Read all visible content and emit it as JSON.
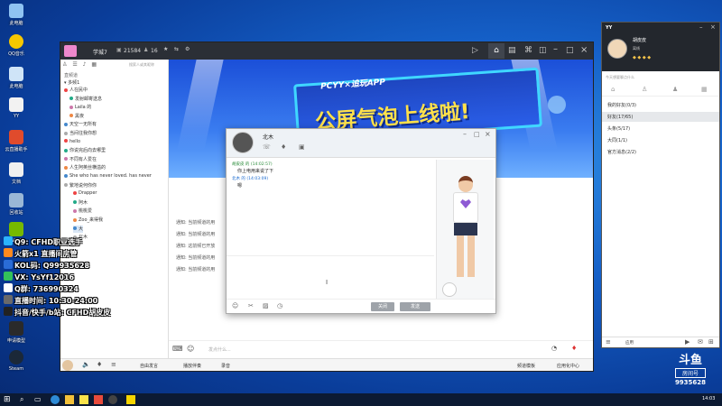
{
  "desktop": {
    "icons": [
      {
        "label": "此电脑"
      },
      {
        "label": "QQ音乐"
      },
      {
        "label": "此电脑"
      },
      {
        "label": "YY"
      },
      {
        "label": "云直播助手"
      },
      {
        "label": "文档"
      },
      {
        "label": "回收站"
      },
      {
        "label": "NVIDIA"
      }
    ],
    "bottom_icons": [
      {
        "label": "申请模型"
      },
      {
        "label": "Steam"
      }
    ]
  },
  "main": {
    "title": "学城7",
    "viewers": "21584",
    "fans": "16",
    "left_header": "直频道",
    "search_placeholder": "搜索人或其昵称",
    "channel_root": "多频1",
    "tree": [
      "人在民中",
      "发射邮寄送息",
      "Laila 的",
      "黑夜",
      "天空一无所有",
      "当间往我你想",
      "hello",
      "你说完后向去哪里",
      "不同有人爱在",
      "人生阿英丝横溢的",
      "She who has never loved. has never",
      "繁地说何你你",
      "Drapper",
      "阿木",
      "桃桃爱",
      "Zoo_来得我",
      "大",
      "北木"
    ],
    "notices": [
      "通知: 当前频道的用",
      "通知: 当前频道的用",
      "通知: 这前频已开放",
      "通知: 当前频道的用",
      "通知: 当前频道的用"
    ],
    "banner_tag": "PCYY×追玩APP",
    "banner_text": "公屏气泡上线啦!",
    "input_placeholder": "发点什么...",
    "bottom_toolbar": [
      "自由发言",
      "播放伴奏",
      "录音"
    ],
    "status_right": [
      "频道模板",
      "应用化中心"
    ]
  },
  "chat": {
    "contact_name": "北木",
    "messages": [
      {
        "sender": "胡皮皮 的",
        "time": "(14:02:57)",
        "text": "你上电用来说了下"
      },
      {
        "sender": "北木 的",
        "time": "(14:03:09)",
        "text": "嗯"
      }
    ],
    "close_label": "关闭",
    "send_label": "发送"
  },
  "friends": {
    "title": "YY",
    "username": "胡皮皮",
    "status": "离线",
    "search_placeholder": "今天想要聊点什么",
    "groups": [
      "我的好友(0/3)",
      "好友(17/65)",
      "头条(5/17)",
      "大同(1/1)",
      "官方消息(2/2)"
    ],
    "footer": "应用"
  },
  "overlay": {
    "rows": [
      "Q9: CFHD职业选手",
      "火箭x1 直播间房管",
      "KOL码: Q99935628",
      "VX: YsYf12016",
      "Q群: 736990324",
      "直播时间: 10:30-24:00",
      "抖音/快手/b站: CFHD胡皮皮"
    ]
  },
  "douyu": {
    "logo": "斗鱼",
    "room_label": "房间号",
    "room_no": "9935628"
  },
  "taskbar": {
    "time": "14:03"
  }
}
